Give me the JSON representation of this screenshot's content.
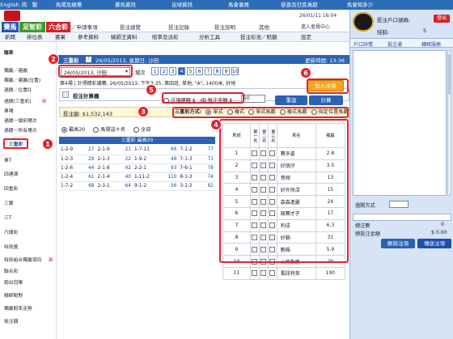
{
  "topbar": {
    "items": [
      "English",
      "简",
      "繁",
      "馬場及娛樂",
      "賽馬資訊",
      "足球資訊",
      "馬會會員",
      "慈善及社區貢獻",
      "馬會知多少"
    ]
  },
  "header": {
    "brands": [
      "賽馬",
      "足智彩",
      "六合彩"
    ],
    "links": [
      "登記／申請事項",
      "投注總覽",
      "投注記錄",
      "投注說明",
      "其他"
    ],
    "datetime": "26/01/11 16:04",
    "user_link": "進入會員中心"
  },
  "nav": {
    "items": [
      "新聞",
      "排位表",
      "賽果",
      "參考資料",
      "騎師王資料",
      "賠率及派彩",
      "分析工具",
      "投注彩池／賠額",
      "設定"
    ]
  },
  "sidebar": {
    "title": "賭率",
    "items": [
      "獨贏／連贏",
      "獨贏／連贏(位置)",
      "過關／位置Q",
      "過關(三重彩)",
      "單場",
      "過關－個別場次",
      "過關－所有場次",
      "三重彩",
      "單T",
      "四連環",
      "四重彩",
      "三寶",
      "三T",
      "六環彩",
      "特別獎",
      "特別組合獨贏項目",
      "聯合彩",
      "跑出冠軍",
      "騎師配對",
      "獨贏賠率走勢",
      "投注額"
    ],
    "new_tags": [
      "新",
      "新"
    ]
  },
  "main": {
    "title_bar": "三重彩",
    "date_line": "26/05/2013, 星期日, 沙田",
    "update_label": "更新時間: 13:36",
    "date_select": "26/05/2013, 沙田",
    "race_label": "場次",
    "races": [
      "1",
      "2",
      "3",
      "4",
      "5",
      "6",
      "7",
      "8",
      "9",
      "10"
    ],
    "active_race": "4",
    "race_info": "第4場 | 計得精彩讓賽, 26/05/2013, 下午3:35, 第四班, 草地, \"A\", 1400米, 好地",
    "calc_label": "投注計算機",
    "opt_unit": "注項總額 $",
    "opt_each": "每注金額 $",
    "each_value": "10",
    "add_btn": "加入注項",
    "clear_btn": "重設",
    "calc_btn": "計算",
    "pool_label": "投注額: $1,532,143",
    "method_label": "三重彩方式:",
    "methods": [
      "單式",
      "複式",
      "單式馬膽",
      "複式馬膽",
      "指定位置馬膽"
    ],
    "view_opts": [
      "最高20",
      "馬號這十名",
      "全部"
    ],
    "odds_header": "三重彩 最高20",
    "odds_rows": [
      [
        "1-2-9",
        "27",
        "2-1-9",
        "21",
        "1-7-11",
        "66",
        "7-1-2",
        "77"
      ],
      [
        "1-2-3",
        "29",
        "2-1-3",
        "22",
        "1-9-2",
        "49",
        "7-1-3",
        "71"
      ],
      [
        "1-2-6",
        "44",
        "2-1-8",
        "42",
        "2-2-1",
        "93",
        "7-6-1",
        "78"
      ],
      [
        "1-2-4",
        "61",
        "2-1-4",
        "40",
        "1-11-2",
        "110",
        "8-1-3",
        "74"
      ],
      [
        "1-7-2",
        "68",
        "2-3-1",
        "64",
        "9-1-2",
        "56",
        "3-1-2",
        "82"
      ]
    ],
    "table_headers": [
      "馬號",
      "第一名",
      "第二名",
      "第三名",
      "馬名",
      "獨贏"
    ],
    "horses": [
      [
        "1",
        "賽多姿",
        "2.8"
      ],
      [
        "2",
        "好朋仔",
        "3.5"
      ],
      [
        "3",
        "貴翔",
        "13"
      ],
      [
        "4",
        "好外快活",
        "15"
      ],
      [
        "5",
        "森森進麗",
        "24"
      ],
      [
        "6",
        "競賽才子",
        "17"
      ],
      [
        "7",
        "利成",
        "6.3"
      ],
      [
        "8",
        "好錦",
        "31"
      ],
      [
        "9",
        "數碼",
        "5.9"
      ],
      [
        "10",
        "火熱動感",
        "20"
      ],
      [
        "11",
        "電訊特首",
        "190"
      ]
    ]
  },
  "right": {
    "account_label": "投注戶口號碼:",
    "balance_label": "結餘:",
    "balance_value": "5",
    "logout": "登出",
    "links": [
      "戶口詳情",
      "投注通",
      "轉賬服務"
    ],
    "count_label": "過關方式",
    "bet_total": "總注數",
    "bet_total_value": "0",
    "bet_amount": "總投注金額",
    "bet_amount_value": "$ 0.00",
    "delete_btn": "刪除注項",
    "send_btn": "傳送注項"
  },
  "markers": [
    "1",
    "2",
    "3",
    "4",
    "5",
    "6"
  ]
}
